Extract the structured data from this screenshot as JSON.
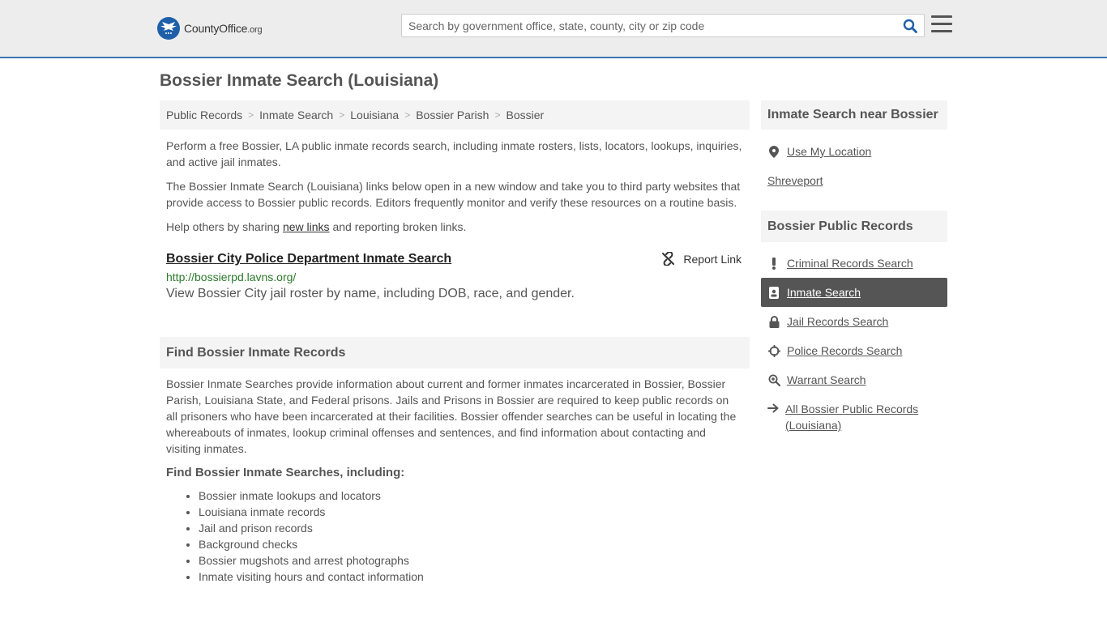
{
  "header": {
    "logo_name": "CountyOffice",
    "logo_tld": ".org",
    "search_placeholder": "Search by government office, state, county, city or zip code"
  },
  "page_title": "Bossier Inmate Search (Louisiana)",
  "breadcrumb": [
    "Public Records",
    "Inmate Search",
    "Louisiana",
    "Bossier Parish",
    "Bossier"
  ],
  "intro": {
    "p1": "Perform a free Bossier, LA public inmate records search, including inmate rosters, lists, locators, lookups, inquiries, and active jail inmates.",
    "p2": "The Bossier Inmate Search (Louisiana) links below open in a new window and take you to third party websites that provide access to Bossier public records. Editors frequently monitor and verify these resources on a routine basis.",
    "p3_before": "Help others by sharing ",
    "p3_link": "new links",
    "p3_after": " and reporting broken links."
  },
  "listing": {
    "title": "Bossier City Police Department Inmate Search",
    "report_label": "Report Link",
    "url": "http://bossierpd.lavns.org/",
    "description": "View Bossier City jail roster by name, including DOB, race, and gender."
  },
  "find_section": {
    "heading": "Find Bossier Inmate Records",
    "paragraph": "Bossier Inmate Searches provide information about current and former inmates incarcerated in Bossier, Bossier Parish, Louisiana State, and Federal prisons. Jails and Prisons in Bossier are required to keep public records on all prisoners who have been incarcerated at their facilities. Bossier offender searches can be useful in locating the whereabouts of inmates, lookup criminal offenses and sentences, and find information about contacting and visiting inmates.",
    "subheading": "Find Bossier Inmate Searches, including:",
    "bullets": [
      "Bossier inmate lookups and locators",
      "Louisiana inmate records",
      "Jail and prison records",
      "Background checks",
      "Bossier mugshots and arrest photographs",
      "Inmate visiting hours and contact information"
    ]
  },
  "sidebar": {
    "near_heading": "Inmate Search near Bossier",
    "use_location": "Use My Location",
    "nearby": [
      "Shreveport"
    ],
    "records_heading": "Bossier Public Records",
    "records": [
      {
        "label": "Criminal Records Search",
        "icon": "exclamation-icon"
      },
      {
        "label": "Inmate Search",
        "icon": "id-badge-icon",
        "active": true
      },
      {
        "label": "Jail Records Search",
        "icon": "lock-icon"
      },
      {
        "label": "Police Records Search",
        "icon": "crosshair-icon"
      },
      {
        "label": "Warrant Search",
        "icon": "magnify-icon"
      },
      {
        "label": "All Bossier Public Records (Louisiana)",
        "icon": "arrow-right-icon"
      }
    ]
  },
  "colors": {
    "brand_blue": "#1f5fa8",
    "header_border": "#3d74b3",
    "url_green": "#2b7a2b",
    "active_bg": "#555555"
  }
}
